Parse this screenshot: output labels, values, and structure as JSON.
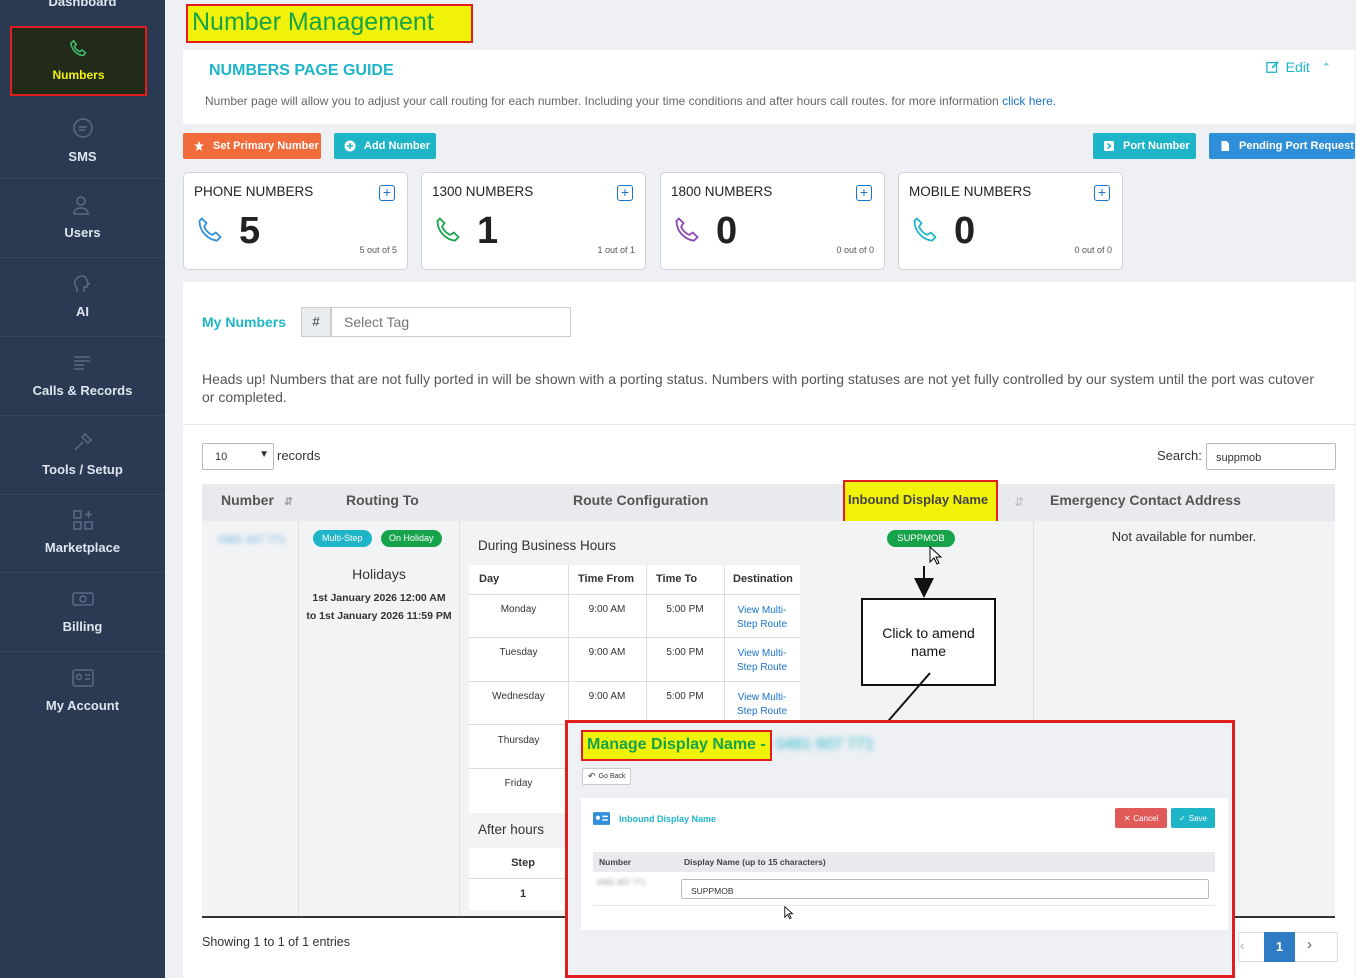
{
  "sidebar": {
    "top_partial": "Dashboard",
    "items": [
      {
        "label": "Numbers"
      },
      {
        "label": "SMS"
      },
      {
        "label": "Users"
      },
      {
        "label": "AI"
      },
      {
        "label": "Calls & Records"
      },
      {
        "label": "Tools / Setup"
      },
      {
        "label": "Marketplace"
      },
      {
        "label": "Billing"
      },
      {
        "label": "My Account"
      }
    ]
  },
  "page": {
    "title": "Number Management"
  },
  "guide": {
    "title": "NUMBERS PAGE GUIDE",
    "edit": "Edit",
    "text": "Number page will allow you to adjust your call routing for each number. Including your time conditions and after hours call routes. for more information ",
    "link": "click here."
  },
  "actions": {
    "set_primary": "Set Primary Number",
    "add_number": "Add Number",
    "port_number": "Port Number",
    "pending_port": "Pending Port Request"
  },
  "cards": [
    {
      "title": "PHONE NUMBERS",
      "count": "5",
      "sub": "5 out of 5"
    },
    {
      "title": "1300 NUMBERS",
      "count": "1",
      "sub": "1 out of 1"
    },
    {
      "title": "1800 NUMBERS",
      "count": "0",
      "sub": "0 out of 0"
    },
    {
      "title": "MOBILE NUMBERS",
      "count": "0",
      "sub": "0 out of 0"
    }
  ],
  "my_numbers": {
    "label": "My Numbers",
    "hash": "#",
    "tag_placeholder": "Select Tag",
    "headsup": "Heads up! Numbers that are not fully ported in will be shown with a porting status. Numbers with porting statuses are not yet fully controlled by our system until the port was cutover or completed."
  },
  "table_controls": {
    "records_value": "10",
    "records_label": "records",
    "search_label": "Search:",
    "search_value": "suppmob"
  },
  "columns": [
    "Number",
    "Routing To",
    "Route Configuration",
    "Inbound Display Name",
    "Emergency Contact Address"
  ],
  "row": {
    "number": "0481 607 771",
    "badges": [
      "Multi-Step",
      "On Holiday"
    ],
    "holidays_title": "Holidays",
    "holidays_text": "1st January 2026 12:00 AM to 1st January 2026 11:59 PM",
    "business_hours": "During Business Hours",
    "schedule_headers": [
      "Day",
      "Time From",
      "Time To",
      "Destination"
    ],
    "schedule": [
      {
        "day": "Monday",
        "from": "9:00 AM",
        "to": "5:00 PM",
        "dest": "View Multi-Step Route"
      },
      {
        "day": "Tuesday",
        "from": "9:00 AM",
        "to": "5:00 PM",
        "dest": "View Multi-Step Route"
      },
      {
        "day": "Wednesday",
        "from": "9:00 AM",
        "to": "5:00 PM",
        "dest": "View Multi-Step Route"
      },
      {
        "day": "Thursday"
      },
      {
        "day": "Friday"
      }
    ],
    "after_hours": "After hours",
    "step_header": "Step",
    "step_value": "1",
    "display_name": "SUPPMOB",
    "emergency": "Not available for number."
  },
  "footer": {
    "showing": "Showing 1 to 1 of 1 entries",
    "page": "1"
  },
  "callout": {
    "text": "Click to amend name"
  },
  "modal": {
    "title": "Manage Display Name -",
    "number": "0481 607 771",
    "go_back": "Go Back",
    "section": "Inbound Display Name",
    "cancel": "Cancel",
    "save": "Save",
    "col_number": "Number",
    "col_display": "Display Name (up to 15 characters)",
    "row_number": "0481 607 771",
    "display_value": "SUPPMOB"
  },
  "colors": {
    "sidebar": "#2a3a52",
    "teal": "#1fb5c9",
    "orange": "#f26b3a",
    "green": "#16a34a",
    "highlight": "#f0f20a",
    "red": "#e01e1e"
  }
}
